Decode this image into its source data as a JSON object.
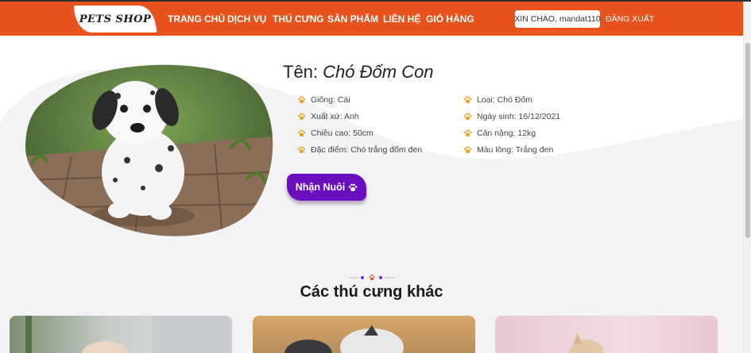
{
  "nav": {
    "logo": "PETS SHOP",
    "items": [
      "TRANG CHỦ",
      "DỊCH VỤ",
      "THÚ CƯNG",
      "SẢN PHẨM",
      "LIÊN HỆ",
      "GIỎ HÀNG"
    ],
    "greeting": "XIN CHÀO, mandat110",
    "logout": "ĐĂNG XUẤT"
  },
  "pet": {
    "name_label": "Tên:",
    "name": "Chó Đốm Con",
    "attributes": [
      "Giống: Cái",
      "Loại: Chó Đốm",
      "Xuất xứ: Anh",
      "Ngày sinh: 16/12/2021",
      "Chiều cao: 50cm",
      "Cân nặng: 12kg",
      "Đặc điểm: Chó trắng đốm đen",
      "Màu lông: Trắng đen"
    ]
  },
  "adopt_button": "Nhận Nuôi",
  "section_title": "Các thú cưng khác",
  "colors": {
    "navbar": "#e8521c",
    "button": "#6a0fbf",
    "paw": "#f0a020"
  },
  "icons": {
    "attribute_bullet": "paw-icon",
    "button_icon": "paw-icon"
  }
}
